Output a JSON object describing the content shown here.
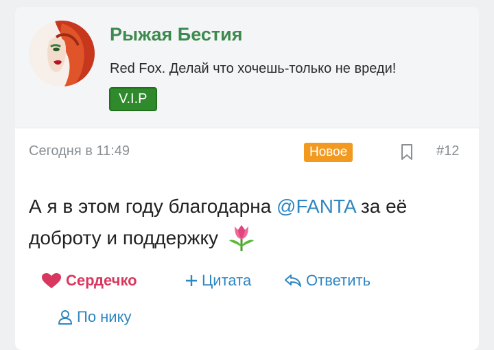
{
  "author": {
    "name": "Рыжая Бестия",
    "status": "Red Fox. Делай что хочешь-только не вреди!",
    "badge": "V.I.P"
  },
  "post": {
    "date": "Сегодня в 11:49",
    "new_badge": "Новое",
    "number": "#12",
    "text_before": "А я в этом году благодарна ",
    "mention": "@FANTA",
    "text_after": " за её доброту и поддержку",
    "emoji_icon": "tulip-icon"
  },
  "actions": {
    "heart": "Сердечко",
    "quote": "Цитата",
    "reply": "Ответить",
    "by_nick": "По нику"
  },
  "colors": {
    "name_green": "#3d8a4e",
    "vip_green": "#2f8a2c",
    "new_orange": "#f29a1f",
    "link_blue": "#2e86c1",
    "heart_red": "#d9375e"
  }
}
